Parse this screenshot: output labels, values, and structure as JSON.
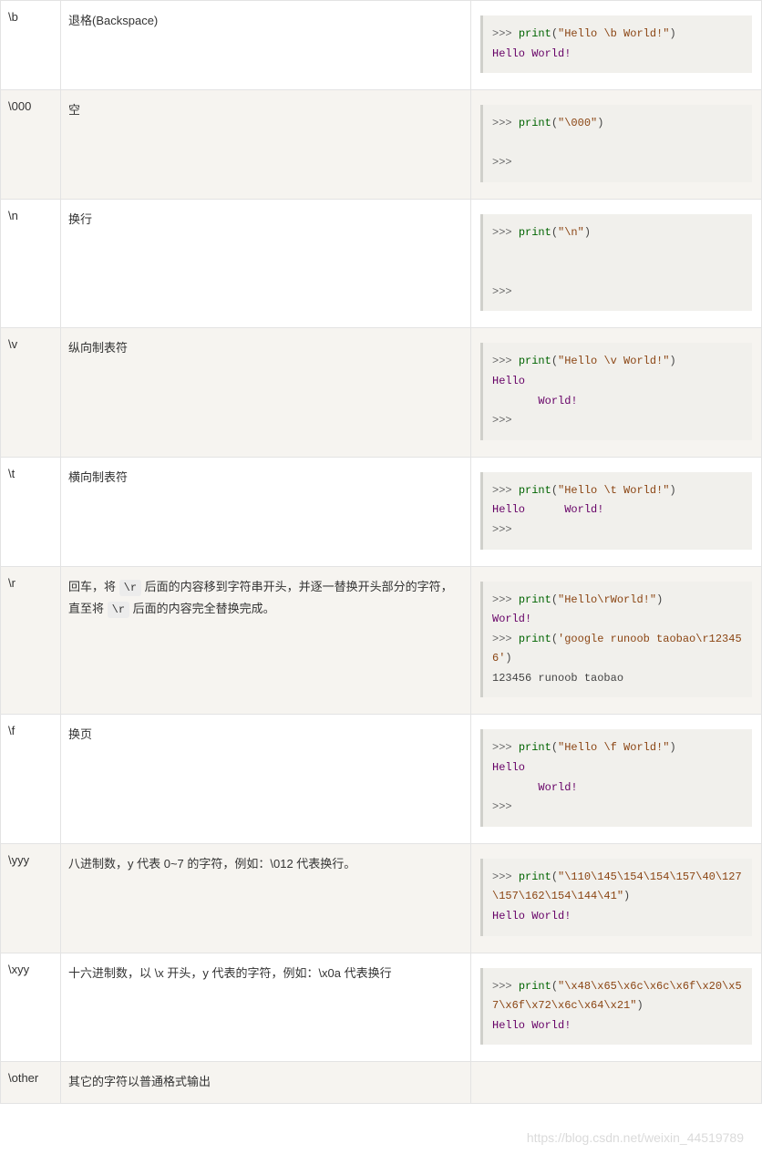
{
  "rows": [
    {
      "esc": "\\b",
      "desc_html": "退格(Backspace)",
      "code_html": "<span class='pr'>&gt;&gt;&gt;</span> <span class='kw'>print</span>(<span class='st'>\"Hello \\b World!\"</span>)\n<span class='out'>Hello World!</span>"
    },
    {
      "esc": "\\000",
      "desc_html": "空",
      "code_html": "<span class='pr'>&gt;&gt;&gt;</span> <span class='kw'>print</span>(<span class='st'>\"\\000\"</span>)\n\n<span class='pr'>&gt;&gt;&gt;</span>"
    },
    {
      "esc": "\\n",
      "desc_html": "换行",
      "code_html": "<span class='pr'>&gt;&gt;&gt;</span> <span class='kw'>print</span>(<span class='st'>\"\\n\"</span>)\n\n\n<span class='pr'>&gt;&gt;&gt;</span>"
    },
    {
      "esc": "\\v",
      "desc_html": "纵向制表符",
      "code_html": "<span class='pr'>&gt;&gt;&gt;</span> <span class='kw'>print</span>(<span class='st'>\"Hello \\v World!\"</span>)\n<span class='out'>Hello</span>\n<span class='out'>       World!</span>\n<span class='pr'>&gt;&gt;&gt;</span>"
    },
    {
      "esc": "\\t",
      "desc_html": "横向制表符",
      "code_html": "<span class='pr'>&gt;&gt;&gt;</span> <span class='kw'>print</span>(<span class='st'>\"Hello \\t World!\"</span>)\n<span class='out'>Hello      World!</span>\n<span class='pr'>&gt;&gt;&gt;</span>"
    },
    {
      "esc": "\\r",
      "desc_html": "回车，将 <code>\\r</code> 后面的内容移到字符串开头，并逐一替换开头部分的字符，直至将 <code>\\r</code> 后面的内容完全替换完成。",
      "code_html": "<span class='pr'>&gt;&gt;&gt;</span> <span class='kw'>print</span>(<span class='st'>\"Hello\\rWorld!\"</span>)\n<span class='out'>World!</span>\n<span class='pr'>&gt;&gt;&gt;</span> <span class='kw'>print</span>(<span class='st'>'google runoob taobao\\r123456'</span>)\n<span class='out2'>123456 runoob taobao</span>"
    },
    {
      "esc": "\\f",
      "desc_html": "换页",
      "code_html": "<span class='pr'>&gt;&gt;&gt;</span> <span class='kw'>print</span>(<span class='st'>\"Hello \\f World!\"</span>)\n<span class='out'>Hello</span>\n<span class='out'>       World!</span>\n<span class='pr'>&gt;&gt;&gt;</span>"
    },
    {
      "esc": "\\yyy",
      "desc_html": "八进制数，y 代表 0~7 的字符，例如：\\012 代表换行。",
      "code_html": "<span class='pr'>&gt;&gt;&gt;</span> <span class='kw'>print</span>(<span class='st'>\"\\110\\145\\154\\154\\157\\40\\127\\157\\162\\154\\144\\41\"</span>)\n<span class='out'>Hello World!</span>"
    },
    {
      "esc": "\\xyy",
      "desc_html": "十六进制数，以 \\x 开头，y 代表的字符，例如：\\x0a 代表换行",
      "code_html": "<span class='pr'>&gt;&gt;&gt;</span> <span class='kw'>print</span>(<span class='st'>\"\\x48\\x65\\x6c\\x6c\\x6f\\x20\\x57\\x6f\\x72\\x6c\\x64\\x21\"</span>)\n<span class='out'>Hello World!</span>"
    },
    {
      "esc": "\\other",
      "desc_html": "其它的字符以普通格式输出",
      "code_html": ""
    }
  ],
  "watermark": "https://blog.csdn.net/weixin_44519789"
}
